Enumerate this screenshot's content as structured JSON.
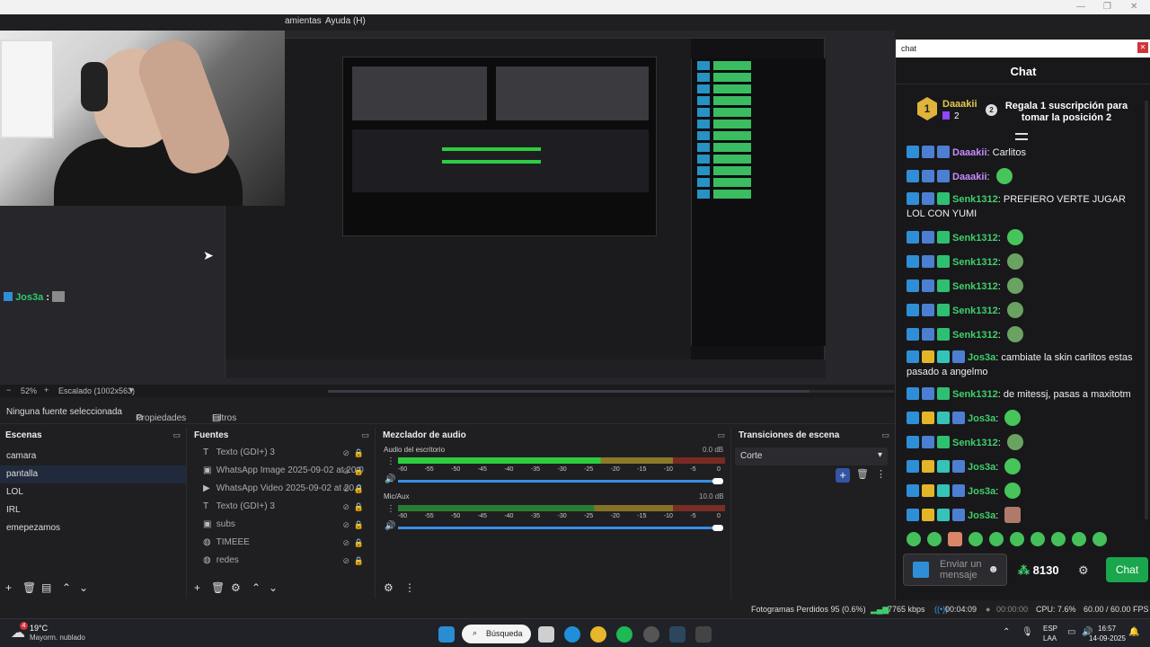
{
  "obs": {
    "menu": {
      "tools_partial": "amientas",
      "help": "Ayuda (H)"
    },
    "left_chat": {
      "user": "Jos3a",
      "sep": ":"
    },
    "preview_status": {
      "minus": "−",
      "zoom": "52%",
      "plus": "+",
      "scaling": "Escalado (1002x563)"
    },
    "stream_progress": 0.85,
    "props_bar": {
      "no_source": "Ninguna fuente seleccionada",
      "properties": "Propiedades",
      "filters": "Filtros"
    },
    "scenes": {
      "title": "Escenas",
      "items": [
        "camara",
        "pantalla",
        "LOL",
        "IRL",
        "emepezamos"
      ],
      "active_index": 1
    },
    "sources": {
      "title": "Fuentes",
      "items": [
        {
          "icon": "text-icon",
          "label": "Texto (GDI+) 3"
        },
        {
          "icon": "image-icon",
          "label": "WhatsApp Image 2025-09-02 at 20.0"
        },
        {
          "icon": "play-icon",
          "label": "WhatsApp Video 2025-09-02 at 20.0"
        },
        {
          "icon": "text-icon",
          "label": "Texto (GDI+) 3"
        },
        {
          "icon": "image-icon",
          "label": "subs"
        },
        {
          "icon": "browser-icon",
          "label": "TIMEEE"
        },
        {
          "icon": "browser-icon",
          "label": "redes"
        }
      ]
    },
    "mixer": {
      "title": "Mezclador de audio",
      "channels": [
        {
          "name": "Audio del escritorio",
          "db": "0.0 dB",
          "level": 0.62
        },
        {
          "name": "Mic/Aux",
          "db": "10.0 dB",
          "level": 0.0
        }
      ],
      "ticks": [
        "-60",
        "-55",
        "-50",
        "-45",
        "-40",
        "-35",
        "-30",
        "-25",
        "-20",
        "-15",
        "-10",
        "-5",
        "0"
      ]
    },
    "transitions": {
      "title": "Transiciones de escena",
      "selected": "Corte"
    },
    "statusbar": {
      "dropped": "Fotogramas Perdidos 95 (0.6%)",
      "kbps": "7765 kbps",
      "rec_time": "00:04:09",
      "stream_time": "00:00:00",
      "cpu": "CPU: 7.6%",
      "fps": "60.00 / 60.00 FPS"
    }
  },
  "taskbar": {
    "weather_temp": "19°C",
    "weather_desc": "Mayorm. nublado",
    "weather_badge": "4",
    "search": "Búsqueda",
    "lang": "ESP",
    "lang_sub": "LAA",
    "time": "16:57",
    "date": "14-09-2025"
  },
  "chat": {
    "window_title": "chat",
    "header": "Chat",
    "pinned": {
      "rank1": "1",
      "name": "Daaakii",
      "count": "2",
      "rank2": "2",
      "text": "Regala 1 suscripción para tomar la posición 2"
    },
    "messages": [
      {
        "user": "Daaakii",
        "color": "#c68cff",
        "text": "Carlitos",
        "emote": null
      },
      {
        "user": "Daaakii",
        "color": "#c68cff",
        "text": "",
        "emote": "pepe"
      },
      {
        "user": "Senk1312",
        "color": "#3fcf6a",
        "text": "PREFIERO VERTE JUGAR LOL CON YUMI",
        "emote": null
      },
      {
        "user": "Senk1312",
        "color": "#3fcf6a",
        "text": "",
        "emote": "pepe"
      },
      {
        "user": "Senk1312",
        "color": "#3fcf6a",
        "text": "",
        "emote": "pepe2"
      },
      {
        "user": "Senk1312",
        "color": "#3fcf6a",
        "text": "",
        "emote": "pepe2"
      },
      {
        "user": "Senk1312",
        "color": "#3fcf6a",
        "text": "",
        "emote": "pepe2"
      },
      {
        "user": "Senk1312",
        "color": "#3fcf6a",
        "text": "",
        "emote": "pepe2"
      },
      {
        "user": "Jos3a",
        "color": "#3fcf6a",
        "text": "cambiate la skin carlitos estas pasado a angelmo",
        "emote": null
      },
      {
        "user": "Senk1312",
        "color": "#3fcf6a",
        "text": "de mitessj, pasas a maxitotm",
        "emote": null
      },
      {
        "user": "Jos3a",
        "color": "#3fcf6a",
        "text": "",
        "emote": "pepe"
      },
      {
        "user": "Senk1312",
        "color": "#3fcf6a",
        "text": "",
        "emote": "pepe2"
      },
      {
        "user": "Jos3a",
        "color": "#3fcf6a",
        "text": "",
        "emote": "pepe"
      },
      {
        "user": "Jos3a",
        "color": "#3fcf6a",
        "text": "",
        "emote": "pepe"
      },
      {
        "user": "Jos3a",
        "color": "#3fcf6a",
        "text": "",
        "emote": "face"
      }
    ],
    "input_placeholder": "Enviar un mensaje",
    "points": "8130",
    "send_label": "Chat"
  }
}
